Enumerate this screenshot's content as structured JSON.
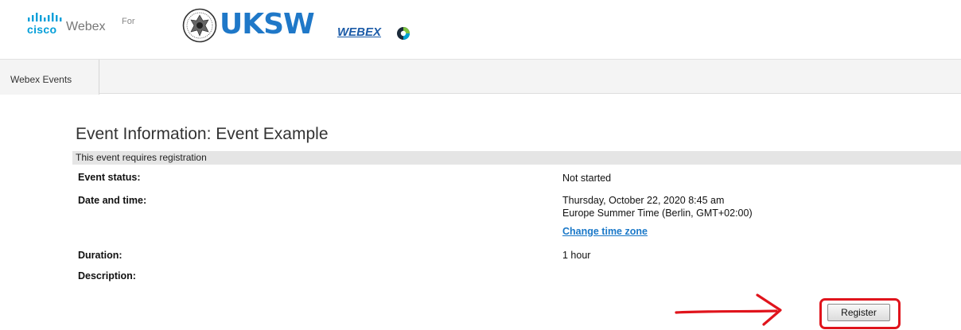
{
  "header": {
    "cisco_text": "cisco",
    "webex_text": "Webex",
    "for_text": "For",
    "uksw_text": "UKSW",
    "webex_sub_text": "WEBEX",
    "colors": {
      "cisco_blue": "#049fd9",
      "uksw_blue": "#1f78c8"
    }
  },
  "nav": {
    "tabs": [
      {
        "label": "Webex Events"
      }
    ]
  },
  "event": {
    "title": "Event Information: Event Example",
    "registration_note": "This event requires registration",
    "fields": [
      {
        "label": "Event status:",
        "value": "Not started"
      },
      {
        "label": "Date and time:",
        "value_line1": "Thursday, October 22, 2020 8:45 am",
        "value_line2": "Europe Summer Time (Berlin, GMT+02:00)",
        "link": "Change time zone"
      },
      {
        "label": "Duration:",
        "value": "1 hour"
      },
      {
        "label": "Description:",
        "value": ""
      }
    ]
  },
  "actions": {
    "register_label": "Register",
    "annotation_color": "#e0141c"
  }
}
